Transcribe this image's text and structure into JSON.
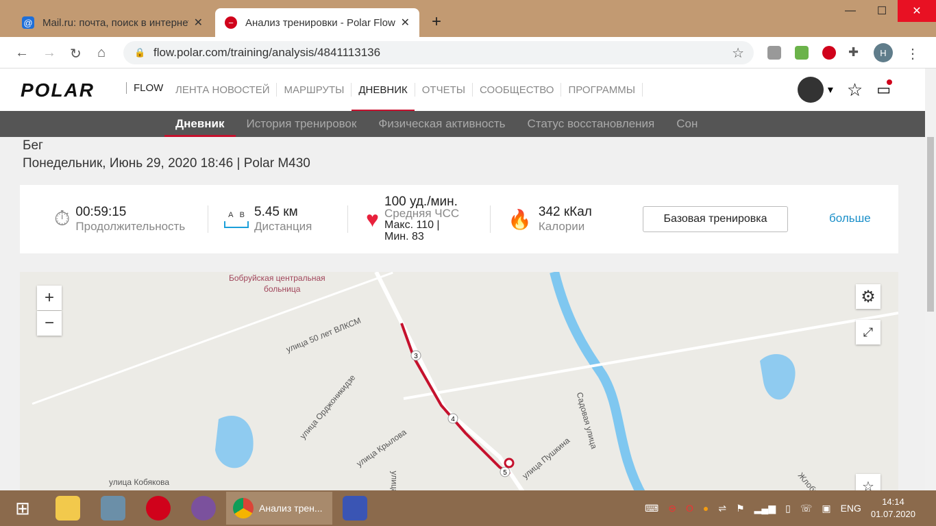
{
  "browser": {
    "tabs": [
      {
        "title": "Mail.ru: почта, поиск в интернете",
        "active": false
      },
      {
        "title": "Анализ тренировки - Polar Flow",
        "active": true
      }
    ],
    "url": "flow.polar.com/training/analysis/4841113136",
    "profile_initial": "H"
  },
  "header": {
    "logo": "POLAR",
    "flow": "FLOW",
    "menu": [
      "ЛЕНТА НОВОСТЕЙ",
      "МАРШРУТЫ",
      "ДНЕВНИК",
      "ОТЧЕТЫ",
      "СООБЩЕСТВО",
      "ПРОГРАММЫ"
    ],
    "active_menu": "ДНЕВНИК"
  },
  "subnav": [
    "Дневник",
    "История тренировок",
    "Физическая активность",
    "Статус восстановления",
    "Сон"
  ],
  "training": {
    "sport": "Бег",
    "date_line": "Понедельник, Июнь 29, 2020 18:46 | Polar M430"
  },
  "summary": {
    "duration": "00:59:15",
    "duration_label": "Продолжительность",
    "ab_a": "A",
    "ab_b": "B",
    "distance": "5.45 км",
    "distance_label": "Дистанция",
    "hr": "100 уд./мин.",
    "hr_label": "Средняя ЧСС",
    "hr_max": "Макс. 110  |",
    "hr_min": "Мин. 83",
    "calories": "342 кКал",
    "calories_label": "Калории",
    "training_type": "Базовая тренировка",
    "more": "больше"
  },
  "map": {
    "labels": [
      "Бобруйская центральная",
      "больница",
      "улица 50 лет ВЛКСМ",
      "улица Орджоникидзе",
      "улица Крылова",
      "улица Кобякова",
      "улица Пушкина",
      "Садовая улица",
      "улица",
      "Жлобин"
    ],
    "markers": [
      "3",
      "4",
      "5"
    ],
    "zoom_in": "+",
    "zoom_out": "−",
    "route_color": "#c5112d"
  },
  "taskbar": {
    "active_app": "Анализ трен...",
    "lang": "ENG",
    "time": "14:14",
    "date": "01.07.2020"
  }
}
